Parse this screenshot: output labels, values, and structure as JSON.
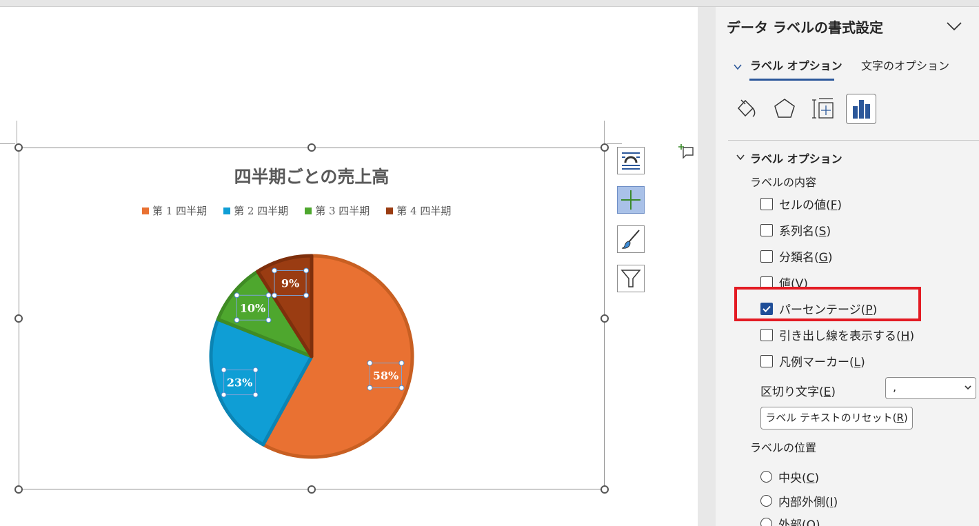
{
  "chart": {
    "title": "四半期ごとの売上高"
  },
  "chart_data": {
    "type": "pie",
    "title": "四半期ごとの売上高",
    "categories": [
      "第 1 四半期",
      "第 2 四半期",
      "第 3 四半期",
      "第 4 四半期"
    ],
    "values": [
      58,
      23,
      10,
      9
    ],
    "data_labels": [
      "58%",
      "23%",
      "10%",
      "9%"
    ],
    "colors": [
      "#e97132",
      "#0f9ed5",
      "#4ea72e",
      "#9a3c12"
    ],
    "legend_position": "top"
  },
  "panel": {
    "title": "データ ラベルの書式設定",
    "tabs": {
      "label_options": "ラベル オプション",
      "text_options": "文字のオプション"
    },
    "section_title": "ラベル オプション",
    "label_contents_title": "ラベルの内容",
    "checkboxes": [
      {
        "label": "セルの値",
        "key": "F",
        "checked": false
      },
      {
        "label": "系列名",
        "key": "S",
        "checked": false
      },
      {
        "label": "分類名",
        "key": "G",
        "checked": false
      },
      {
        "label": "値",
        "key": "V",
        "checked": false
      },
      {
        "label": "パーセンテージ",
        "key": "P",
        "checked": true
      },
      {
        "label": "引き出し線を表示する",
        "key": "H",
        "checked": false
      },
      {
        "label": "凡例マーカー",
        "key": "L",
        "checked": false
      }
    ],
    "separator": {
      "label": "区切り文字",
      "key": "E",
      "value": ","
    },
    "reset_button": {
      "label": "ラベル テキストのリセット",
      "key": "R"
    },
    "label_position_title": "ラベルの位置",
    "positions": [
      {
        "label": "中央",
        "key": "C"
      },
      {
        "label": "内部外側",
        "key": "I"
      },
      {
        "label": "外部",
        "key": "O"
      }
    ]
  }
}
